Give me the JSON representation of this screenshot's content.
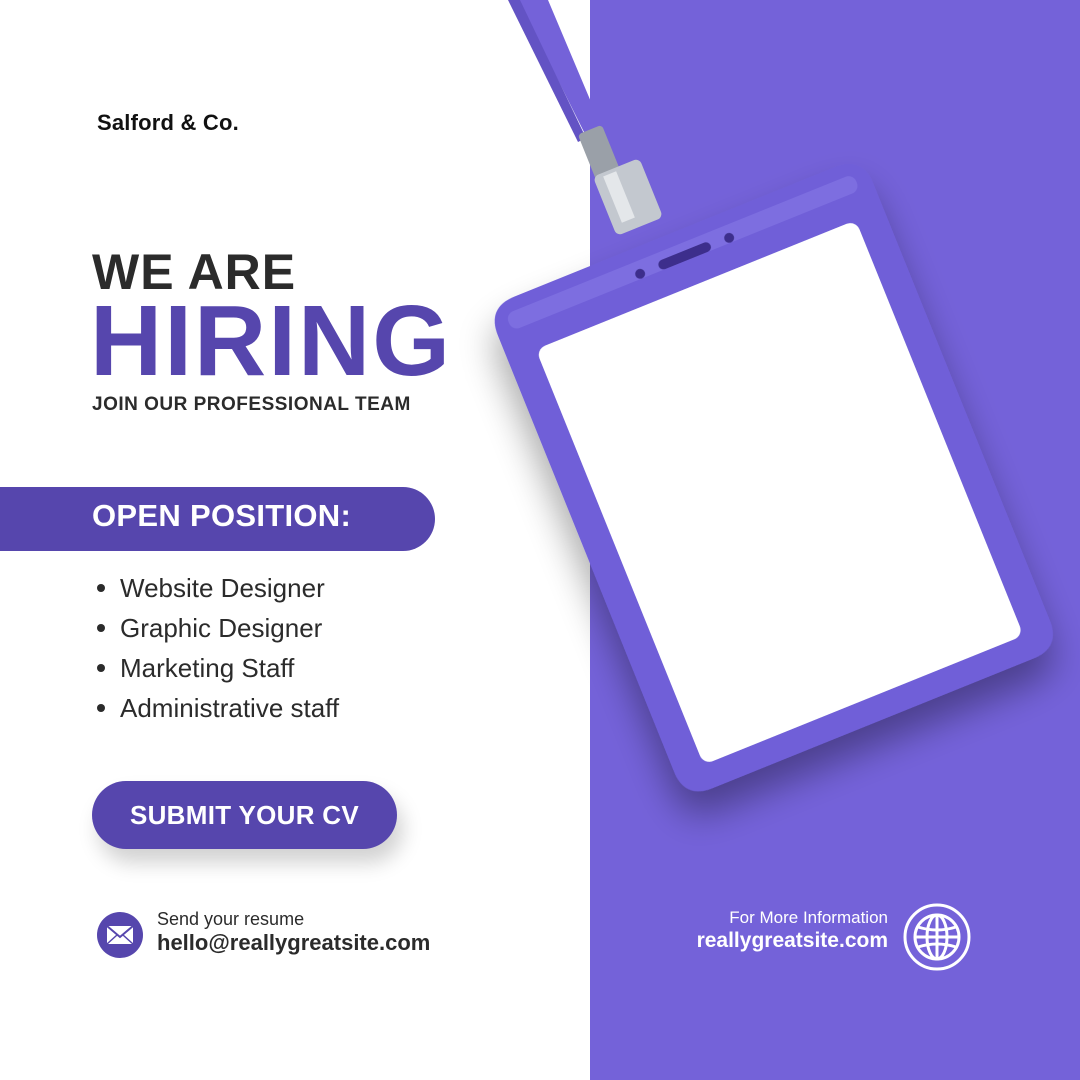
{
  "brand": {
    "name": "Salford & Co."
  },
  "hero": {
    "line1": "WE ARE",
    "line2": "HIRING",
    "subtitle": "JOIN OUR PROFESSIONAL TEAM"
  },
  "open_position": {
    "label": "OPEN POSITION:",
    "items": [
      "Website Designer",
      "Graphic Designer",
      "Marketing Staff",
      "Administrative staff"
    ]
  },
  "cta": {
    "label": "SUBMIT YOUR CV"
  },
  "contact": {
    "resume_label": "Send your resume",
    "email": "hello@reallygreatsite.com",
    "icon": "envelope-icon"
  },
  "info": {
    "label": "For More Information",
    "website": "reallygreatsite.com",
    "icon": "globe-icon"
  },
  "colors": {
    "primary": "#5646ad",
    "panel": "#7462d9",
    "text": "#2b2b2b",
    "background": "#ffffff"
  }
}
